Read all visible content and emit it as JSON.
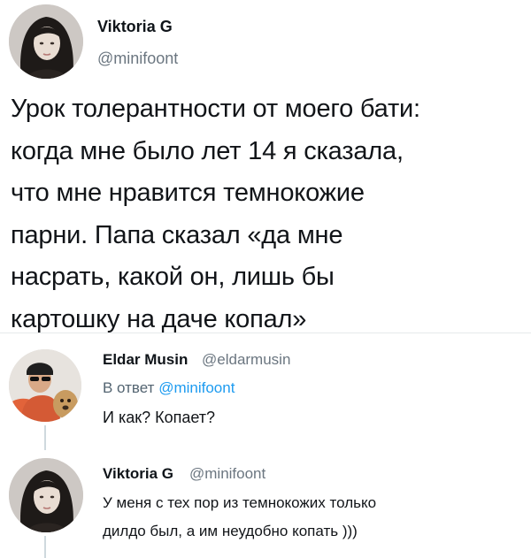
{
  "main_tweet": {
    "author_name": "Viktoria G",
    "author_handle": "@minifoont",
    "text_lines": [
      "Урок толерантности от моего бати:",
      "когда мне было лет 14 я сказала,",
      "что мне нравится темнокожие",
      "парни. Папа сказал «да мне",
      "насрать, какой он, лишь бы",
      "картошку на даче копал»"
    ]
  },
  "reply_1": {
    "author_name": "Eldar Musin",
    "author_handle": "@eldarmusin",
    "reply_to_prefix": "В ответ",
    "reply_to_handle": "@minifoont",
    "text": "И как? Копает?"
  },
  "reply_2": {
    "author_name": "Viktoria G",
    "author_handle": "@minifoont",
    "text_lines": [
      "У меня с тех пор из темнокожих только",
      "дилдо был, а им неудобно копать )))"
    ]
  },
  "colors": {
    "text": "#0f1419",
    "secondary": "#536471",
    "link": "#1d9bf0"
  }
}
